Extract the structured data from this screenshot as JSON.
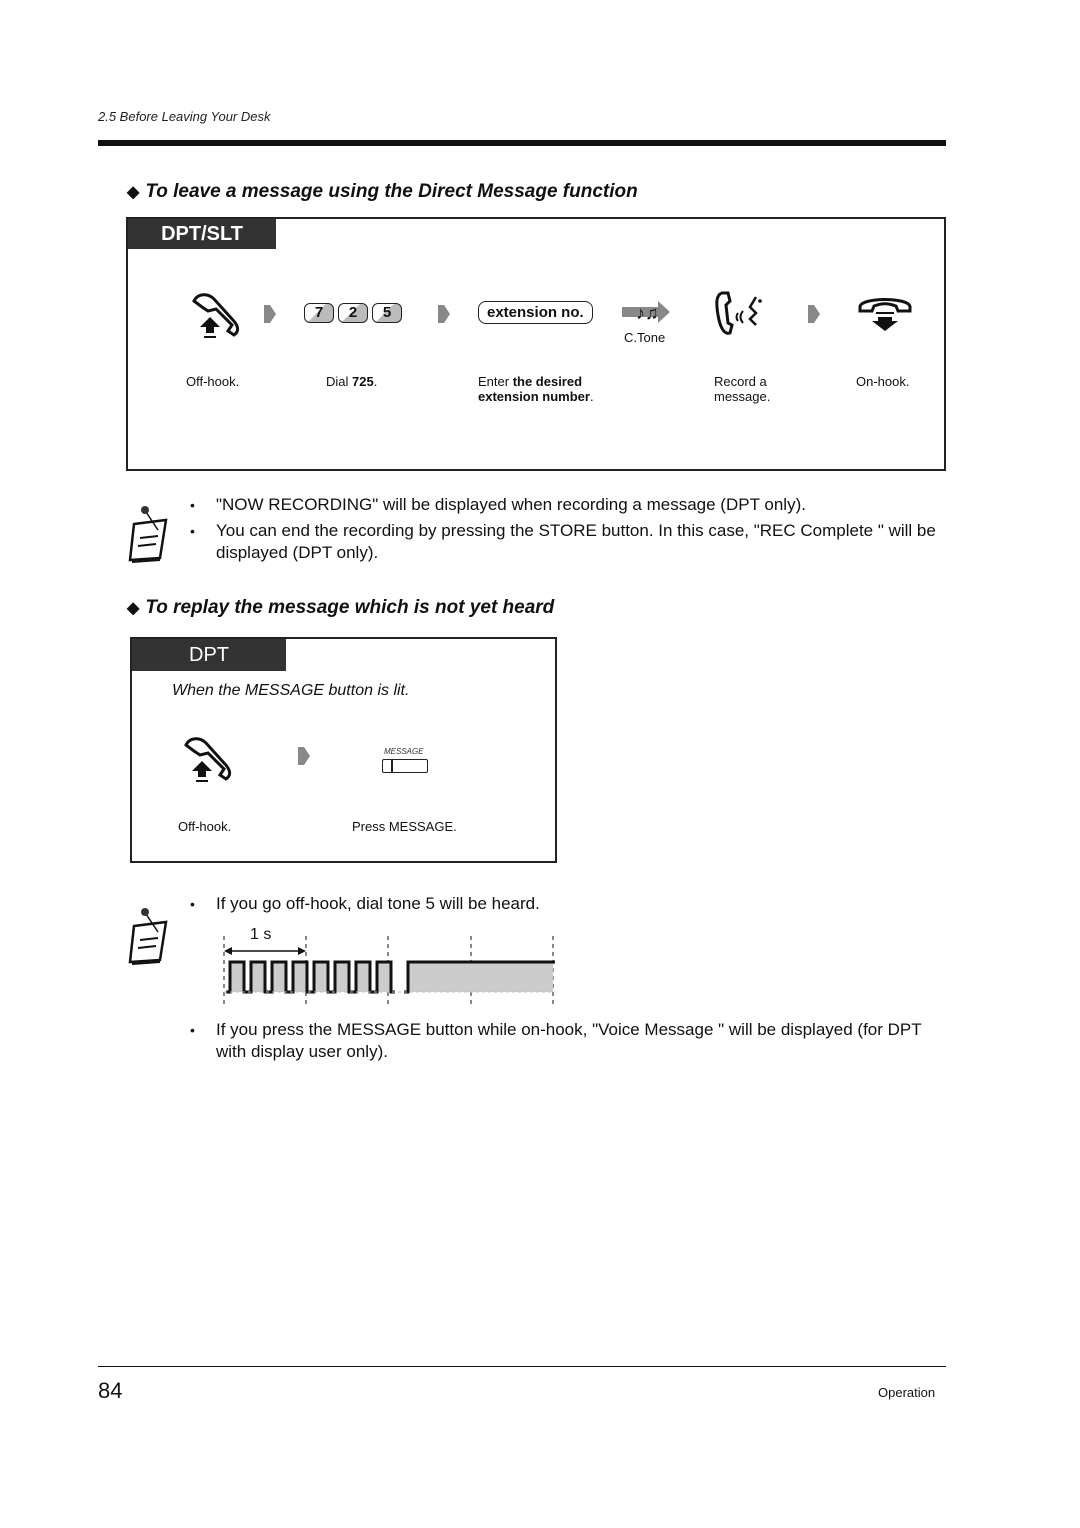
{
  "header": {
    "section_ref": "2.5   Before Leaving Your Desk"
  },
  "section1": {
    "heading": "To leave a message using the Direct Message function",
    "tag": "DPT/SLT",
    "keys": [
      "7",
      "2",
      "5"
    ],
    "extension_button": "extension no.",
    "ctone_label": "C.Tone",
    "steps": [
      {
        "label": "Off-hook."
      },
      {
        "label_prefix": "Dial ",
        "label_bold": "725",
        "label_suffix": "."
      },
      {
        "label_prefix": "Enter ",
        "label_bold": "the desired",
        "label_bold2": "extension number",
        "label_suffix": "."
      },
      {
        "label_line1": "Record a",
        "label_line2": "message."
      },
      {
        "label": "On-hook."
      }
    ],
    "notes": [
      "\"NOW RECORDING\" will be displayed when recording a message (DPT only).",
      "You can end the recording by pressing the STORE button. In this case, \"REC Complete  \" will be displayed (DPT only)."
    ]
  },
  "section2": {
    "heading": "To replay the message which is not yet heard",
    "tag": "DPT",
    "condition": "When the MESSAGE button is lit.",
    "message_key_label": "MESSAGE",
    "steps": [
      {
        "label": "Off-hook."
      },
      {
        "label": "Press MESSAGE."
      }
    ],
    "notes": [
      "If you go off-hook, dial tone 5 will be heard.",
      "If you press the MESSAGE button while on-hook, \"Voice Message    \" will be displayed (for DPT with display user only)."
    ],
    "tone_diagram": {
      "interval_label": "1 s"
    }
  },
  "footer": {
    "page_number": "84",
    "section": "Operation"
  }
}
